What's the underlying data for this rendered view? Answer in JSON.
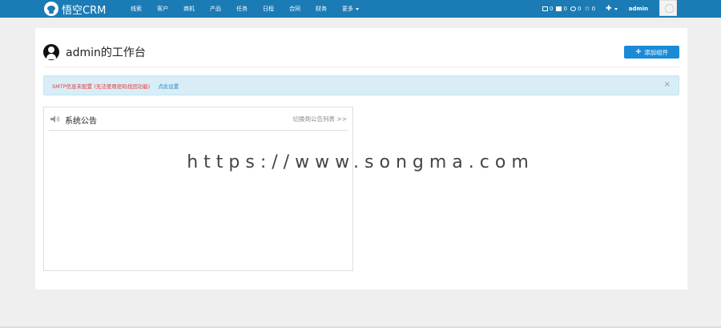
{
  "app": {
    "brand": "悟空CRM"
  },
  "nav": {
    "items": [
      "线索",
      "客户",
      "商机",
      "产品",
      "任务",
      "日程",
      "合同",
      "财务"
    ],
    "more_label": "更多"
  },
  "header_right": {
    "messages_count": "0",
    "tasks_count": "0",
    "settings_count": "0",
    "favorites_count": "0",
    "username": "admin"
  },
  "workspace": {
    "title": "admin的工作台",
    "add_widget_label": "添加组件"
  },
  "alert": {
    "message": "SMTP信息未配置 (无法使用密码找回功能)",
    "link_label": "点此设置",
    "close_glyph": "×"
  },
  "notice_card": {
    "title": "系统公告",
    "link_label": "切换到公告列表 >>"
  },
  "watermark": "https://www.songma.com",
  "colors": {
    "navbar": "#1b7bb5",
    "button": "#1b8ad6",
    "alert_bg": "#d9edf7",
    "alert_text": "#e23a3a",
    "link": "#2a86c8"
  },
  "icons": {
    "logo": "monkey-logo-icon",
    "mail": "mail-icon",
    "tasks": "inbox-icon",
    "settings": "gear-icon",
    "favorites": "star-icon",
    "user": "user-circle-icon",
    "speaker": "speaker-icon"
  }
}
